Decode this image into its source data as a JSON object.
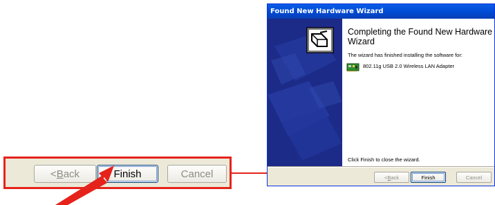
{
  "window": {
    "title": "Found New Hardware Wizard"
  },
  "content": {
    "heading": "Completing the Found New Hardware Wizard",
    "description": "The wizard has finished installing the software for:",
    "device_name": "802.11g USB 2.0 Wireless LAN Adapter",
    "finish_note": "Click Finish to close the wizard."
  },
  "buttons": {
    "back_prefix": "< ",
    "back_mnemonic": "B",
    "back_rest": "ack",
    "finish_label": "Finish",
    "cancel_label": "Cancel"
  },
  "callout": {
    "border_color": "#e5231b",
    "arrow_color": "#e5231b"
  },
  "icons": {
    "wizard_icon": "hardware-box-icon",
    "device_icon": "network-card-icon",
    "pointer_arrow": "red-pointer-arrow-icon"
  }
}
